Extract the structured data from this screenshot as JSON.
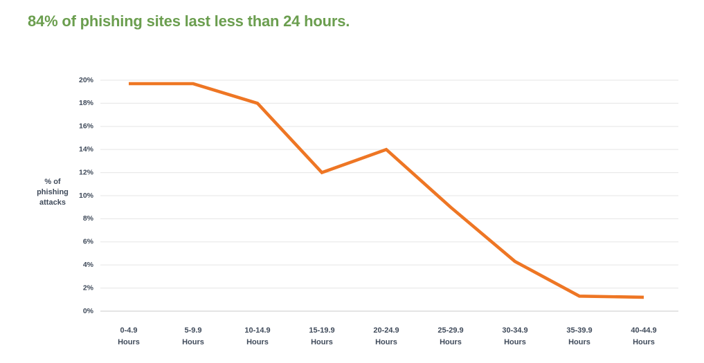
{
  "title": "84% of phishing sites last less than 24 hours.",
  "title_color": "#6b9e4f",
  "axis": {
    "ylabel_line1": "% of",
    "ylabel_line2": "phishing",
    "ylabel_line3": "attacks"
  },
  "chart_data": {
    "type": "line",
    "title": "84% of phishing sites last less than 24 hours.",
    "xlabel": "",
    "ylabel": "% of phishing attacks",
    "ylim": [
      0,
      20
    ],
    "ytick_labels": [
      "0%",
      "2%",
      "4%",
      "6%",
      "8%",
      "10%",
      "12%",
      "14%",
      "16%",
      "18%",
      "20%"
    ],
    "ytick_values": [
      0,
      2,
      4,
      6,
      8,
      10,
      12,
      14,
      16,
      18,
      20
    ],
    "grid": true,
    "legend": "none",
    "line_color": "#ee7624",
    "categories": [
      "0-4.9 Hours",
      "5-9.9 Hours",
      "10-14.9 Hours",
      "15-19.9 Hours",
      "20-24.9 Hours",
      "25-29.9 Hours",
      "30-34.9 Hours",
      "35-39.9 Hours",
      "40-44.9 Hours"
    ],
    "category_lines": [
      [
        "0-4.9",
        "Hours"
      ],
      [
        "5-9.9",
        "Hours"
      ],
      [
        "10-14.9",
        "Hours"
      ],
      [
        "15-19.9",
        "Hours"
      ],
      [
        "20-24.9",
        "Hours"
      ],
      [
        "25-29.9",
        "Hours"
      ],
      [
        "30-34.9",
        "Hours"
      ],
      [
        "35-39.9",
        "Hours"
      ],
      [
        "40-44.9",
        "Hours"
      ]
    ],
    "values": [
      19.7,
      19.7,
      18.0,
      12.0,
      14.0,
      9.0,
      4.3,
      1.3,
      1.2
    ]
  }
}
